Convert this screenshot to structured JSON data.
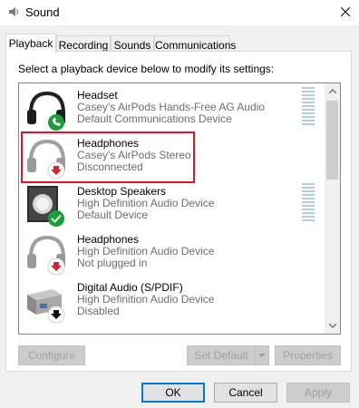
{
  "window": {
    "title": "Sound"
  },
  "tabs": [
    {
      "label": "Playback",
      "active": true
    },
    {
      "label": "Recording"
    },
    {
      "label": "Sounds"
    },
    {
      "label": "Communications"
    }
  ],
  "instruction": "Select a playback device below to modify its settings:",
  "devices": [
    {
      "name": "Headset",
      "line1": "Casey's AirPods Hands-Free AG Audio",
      "line2": "Default Communications Device",
      "icon": "headset-phone-icon",
      "badge": "green-phone"
    },
    {
      "name": "Headphones",
      "line1": "Casey's AirPods Stereo",
      "line2": "Disconnected",
      "icon": "headphones-icon",
      "badge": "red-down-arrow",
      "highlighted": true
    },
    {
      "name": "Desktop Speakers",
      "line1": "High Definition Audio Device",
      "line2": "Default Device",
      "icon": "speaker-icon",
      "badge": "green-check"
    },
    {
      "name": "Headphones",
      "line1": "High Definition Audio Device",
      "line2": "Not plugged in",
      "icon": "headphones-icon",
      "badge": "red-down-arrow"
    },
    {
      "name": "Digital Audio (S/PDIF)",
      "line1": "High Definition Audio Device",
      "line2": "Disabled",
      "icon": "spdif-icon",
      "badge": "black-down-arrow"
    }
  ],
  "buttons": {
    "configure": "Configure",
    "set_default": "Set Default",
    "properties": "Properties",
    "ok": "OK",
    "cancel": "Cancel",
    "apply": "Apply"
  },
  "colors": {
    "highlight": "#e81123",
    "accent": "#0078d7",
    "status_green": "#1a9e3a",
    "status_red": "#d9232e"
  }
}
